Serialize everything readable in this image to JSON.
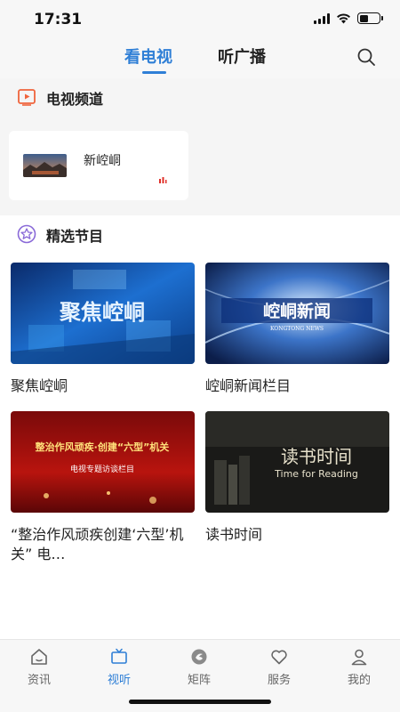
{
  "status_bar": {
    "time": "17:31"
  },
  "top_nav": {
    "tabs": [
      {
        "label": "看电视"
      },
      {
        "label": "听广播"
      }
    ]
  },
  "tv_channels": {
    "title": "电视频道",
    "items": [
      {
        "name": "新崆峒"
      }
    ]
  },
  "featured": {
    "title": "精选节目",
    "items": [
      {
        "title": "聚焦崆峒",
        "thumb_text": "聚焦崆峒"
      },
      {
        "title": "崆峒新闻栏目",
        "thumb_text": "崆峒新闻",
        "thumb_subtext": "KONGTONG NEWS"
      },
      {
        "title": "“整治作风顽疾创建‘六型’机关” 电…",
        "thumb_text": "整治作风顽疾·创建“六型”机关",
        "thumb_subtext": "电视专题访谈栏目"
      },
      {
        "title": "读书时间",
        "thumb_text": "读书时间",
        "thumb_subtext": "Time for Reading"
      }
    ]
  },
  "bottom_nav": {
    "items": [
      {
        "label": "资讯",
        "icon": "home-icon"
      },
      {
        "label": "视听",
        "icon": "tv-icon",
        "active": true
      },
      {
        "label": "矩阵",
        "icon": "matrix-icon"
      },
      {
        "label": "服务",
        "icon": "heart-icon"
      },
      {
        "label": "我的",
        "icon": "user-icon"
      }
    ]
  },
  "colors": {
    "accent": "#2f7fd6",
    "section_icon_orange": "#f0643c",
    "section_icon_purple": "#8a6ad8"
  }
}
